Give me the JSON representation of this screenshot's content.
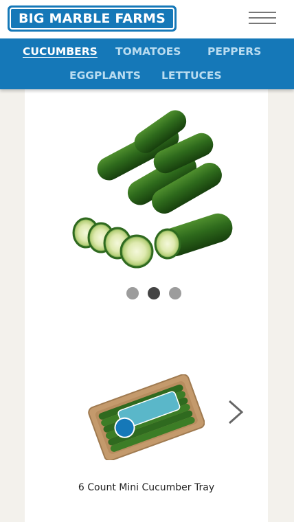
{
  "brand": {
    "name": "BIG MARBLE FARMS"
  },
  "nav": {
    "items": [
      {
        "label": "CUCUMBERS",
        "active": true
      },
      {
        "label": "TOMATOES",
        "active": false
      },
      {
        "label": "PEPPERS",
        "active": false
      },
      {
        "label": "EGGPLANTS",
        "active": false
      },
      {
        "label": "LETTUCES",
        "active": false
      }
    ]
  },
  "carousel": {
    "slide_count": 3,
    "active_slide": 2
  },
  "product": {
    "name": "6 Count Mini Cucumber Tray"
  },
  "colors": {
    "brand_blue": "#1578b8",
    "nav_inactive": "#b9dcf0",
    "cucumber_green": "#2f6a1f"
  },
  "icons": {
    "menu": "hamburger-icon",
    "next": "chevron-right-icon"
  }
}
